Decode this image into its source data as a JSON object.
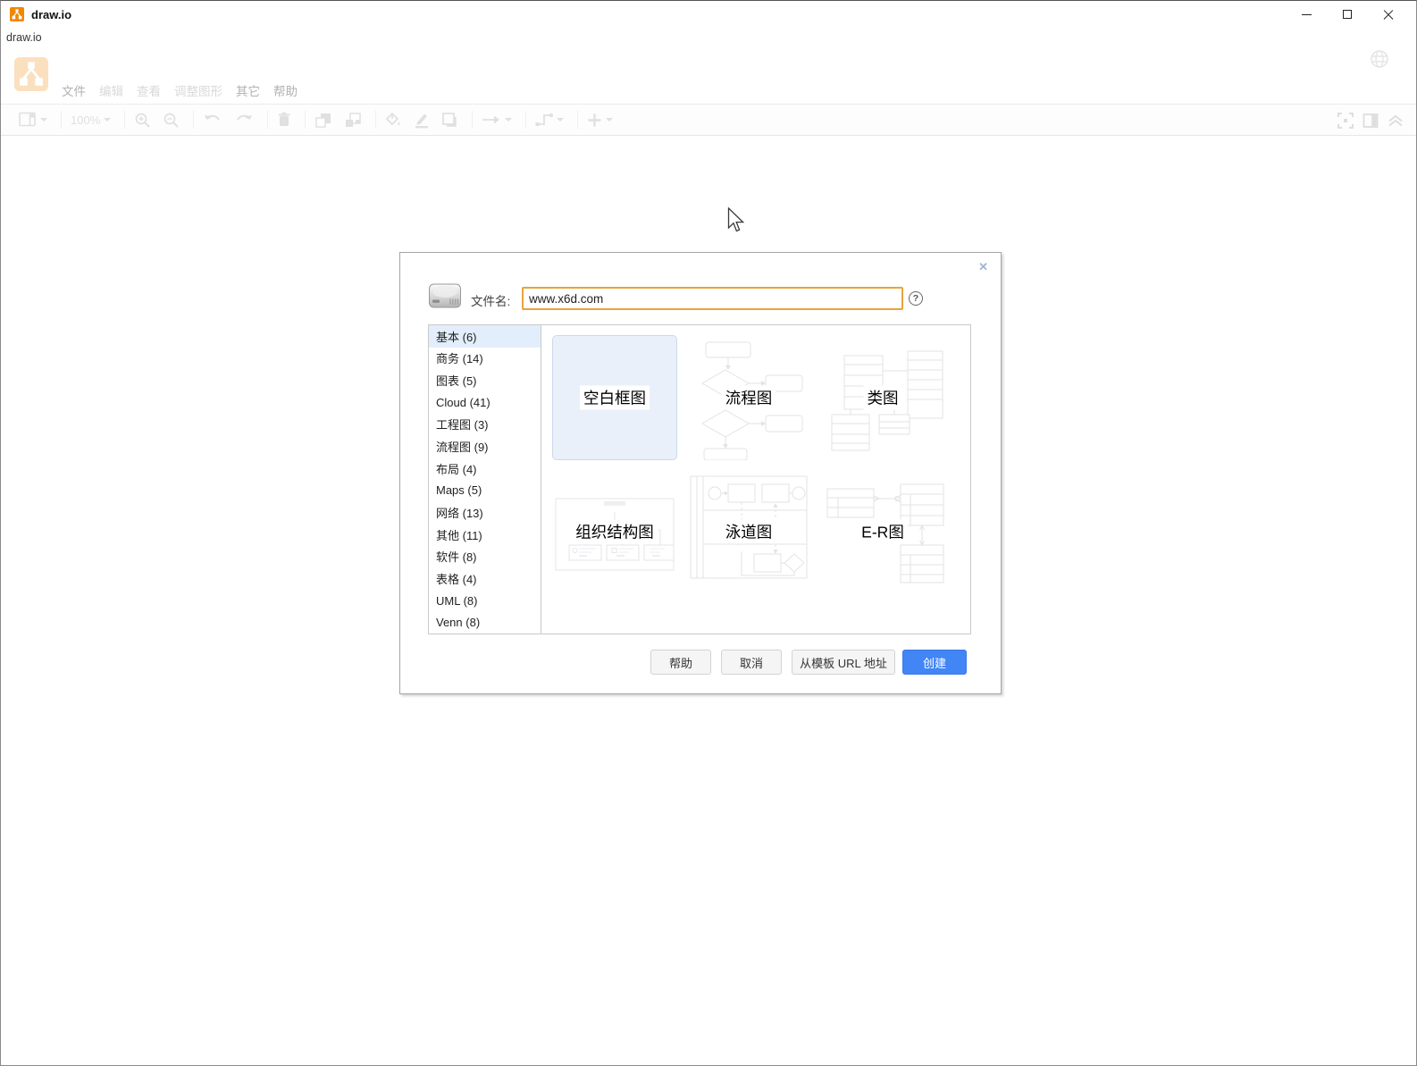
{
  "window": {
    "title": "draw.io",
    "menubar_label": "draw.io"
  },
  "menus": [
    {
      "label": "文件",
      "enabled": true
    },
    {
      "label": "编辑",
      "enabled": false
    },
    {
      "label": "查看",
      "enabled": false
    },
    {
      "label": "调整图形",
      "enabled": false
    },
    {
      "label": "其它",
      "enabled": true
    },
    {
      "label": "帮助",
      "enabled": true
    }
  ],
  "toolbar": {
    "zoom_level": "100%"
  },
  "dialog": {
    "close_icon": "✕",
    "filename_label": "文件名:",
    "filename_value": "www.x6d.com",
    "help_icon": "?",
    "categories": [
      "基本 (6)",
      "商务 (14)",
      "图表 (5)",
      "Cloud (41)",
      "工程图 (3)",
      "流程图 (9)",
      "布局 (4)",
      "Maps (5)",
      "网络 (13)",
      "其他 (11)",
      "软件 (8)",
      "表格 (4)",
      "UML (8)",
      "Venn (8)"
    ],
    "selected_category": "基本 (6)",
    "templates": [
      "空白框图",
      "流程图",
      "类图",
      "组织结构图",
      "泳道图",
      "E-R图"
    ],
    "selected_template": "空白框图",
    "buttons": [
      "帮助",
      "取消",
      "从模板 URL 地址",
      "创建"
    ]
  },
  "colors": {
    "brand_orange": "#F08705",
    "create_button_blue": "#4285f4",
    "input_border_orange": "#e8a33d",
    "selected_tile_bg": "#e9f0f9",
    "selected_category_bg": "#e2eefb"
  }
}
